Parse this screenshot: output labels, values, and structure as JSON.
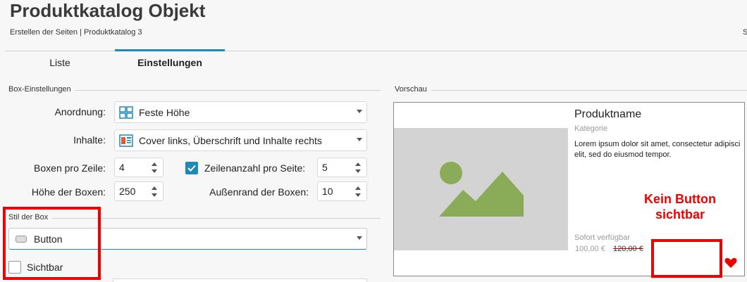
{
  "header": {
    "title": "Produktkatalog Objekt",
    "subtitle": "Erstellen der Seiten | Produktkatalog 3",
    "edge_letter": "S"
  },
  "tabs": [
    {
      "label": "Liste",
      "active": false
    },
    {
      "label": "Einstellungen",
      "active": true
    }
  ],
  "box_settings": {
    "section_label": "Box-Einstellungen",
    "anordnung": {
      "label": "Anordnung:",
      "value": "Feste Höhe",
      "icon": "grid-layout-icon"
    },
    "inhalte": {
      "label": "Inhalte:",
      "value": "Cover links, Überschrift und Inhalte rechts",
      "icon": "cover-layout-icon"
    },
    "boxen_pro_zeile": {
      "label": "Boxen pro Zeile:",
      "value": "4"
    },
    "zeilenanzahl": {
      "label": "Zeilenanzahl pro Seite:",
      "value": "5",
      "checked": true
    },
    "hoehe_boxen": {
      "label": "Höhe der Boxen:",
      "value": "250"
    },
    "aussenrand": {
      "label": "Außenrand der Boxen:",
      "value": "10"
    }
  },
  "box_style": {
    "section_label": "Stil der Box",
    "style_value": "Button",
    "visible_label": "Sichtbar",
    "visible_checked": false
  },
  "preview": {
    "section_label": "Vorschau",
    "product_name": "Produktname",
    "category": "Kategorie",
    "description": "Lorem ipsum dolor sit amet, consectetur adipisci elit, sed do eiusmod tempor.",
    "availability": "Sofort verfügbar",
    "price": "100,00 €",
    "old_price": "120,00 €"
  },
  "annotation": {
    "text_line1": "Kein Button",
    "text_line2": "sichtbar"
  },
  "colors": {
    "accent": "#1e88b8",
    "annotation_red": "#ee0000",
    "image_green": "#8aab58",
    "image_bg": "#d3d3d3",
    "heart": "#ee0000"
  }
}
